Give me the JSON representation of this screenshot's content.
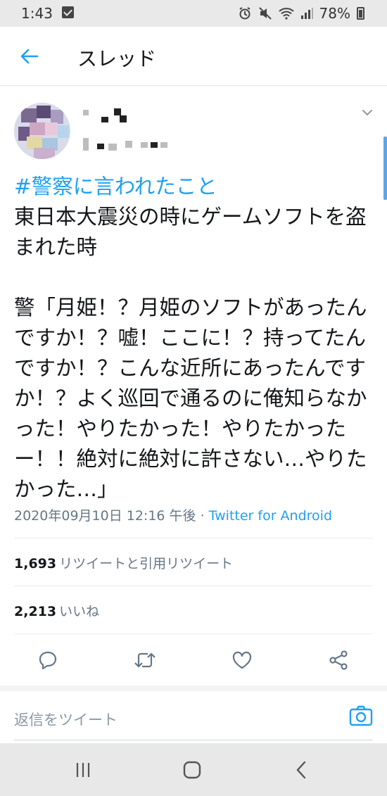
{
  "status_bar": {
    "time": "1:43",
    "battery": "78%"
  },
  "header": {
    "title": "スレッド"
  },
  "tweet": {
    "hashtag": "#警察に言われたこと",
    "body": "東日本大震災の時にゲームソフトを盗まれた時\n\n警「月姫！？月姫のソフトがあったんですか！？嘘！ここに！？持ってたんですか！？こんな近所にあったんですか！？よく巡回で通るのに俺知らなかった！やりたかった！やりたかったー！！絶対に絶対に許さない…やりたかった…」",
    "timestamp": "2020年09月10日 12:16 午後 · ",
    "source": "Twitter for Android",
    "retweets": {
      "count": "1,693",
      "label": "リツイートと引用リツイート"
    },
    "likes": {
      "count": "2,213",
      "label": "いいね"
    }
  },
  "reply": {
    "placeholder": "返信をツイート"
  },
  "colors": {
    "accent": "#1da1f2",
    "secondary_text": "#657786"
  },
  "icons": [
    "back-arrow-icon",
    "chevron-down-icon",
    "reply-icon",
    "retweet-icon",
    "like-icon",
    "share-icon",
    "camera-icon"
  ]
}
